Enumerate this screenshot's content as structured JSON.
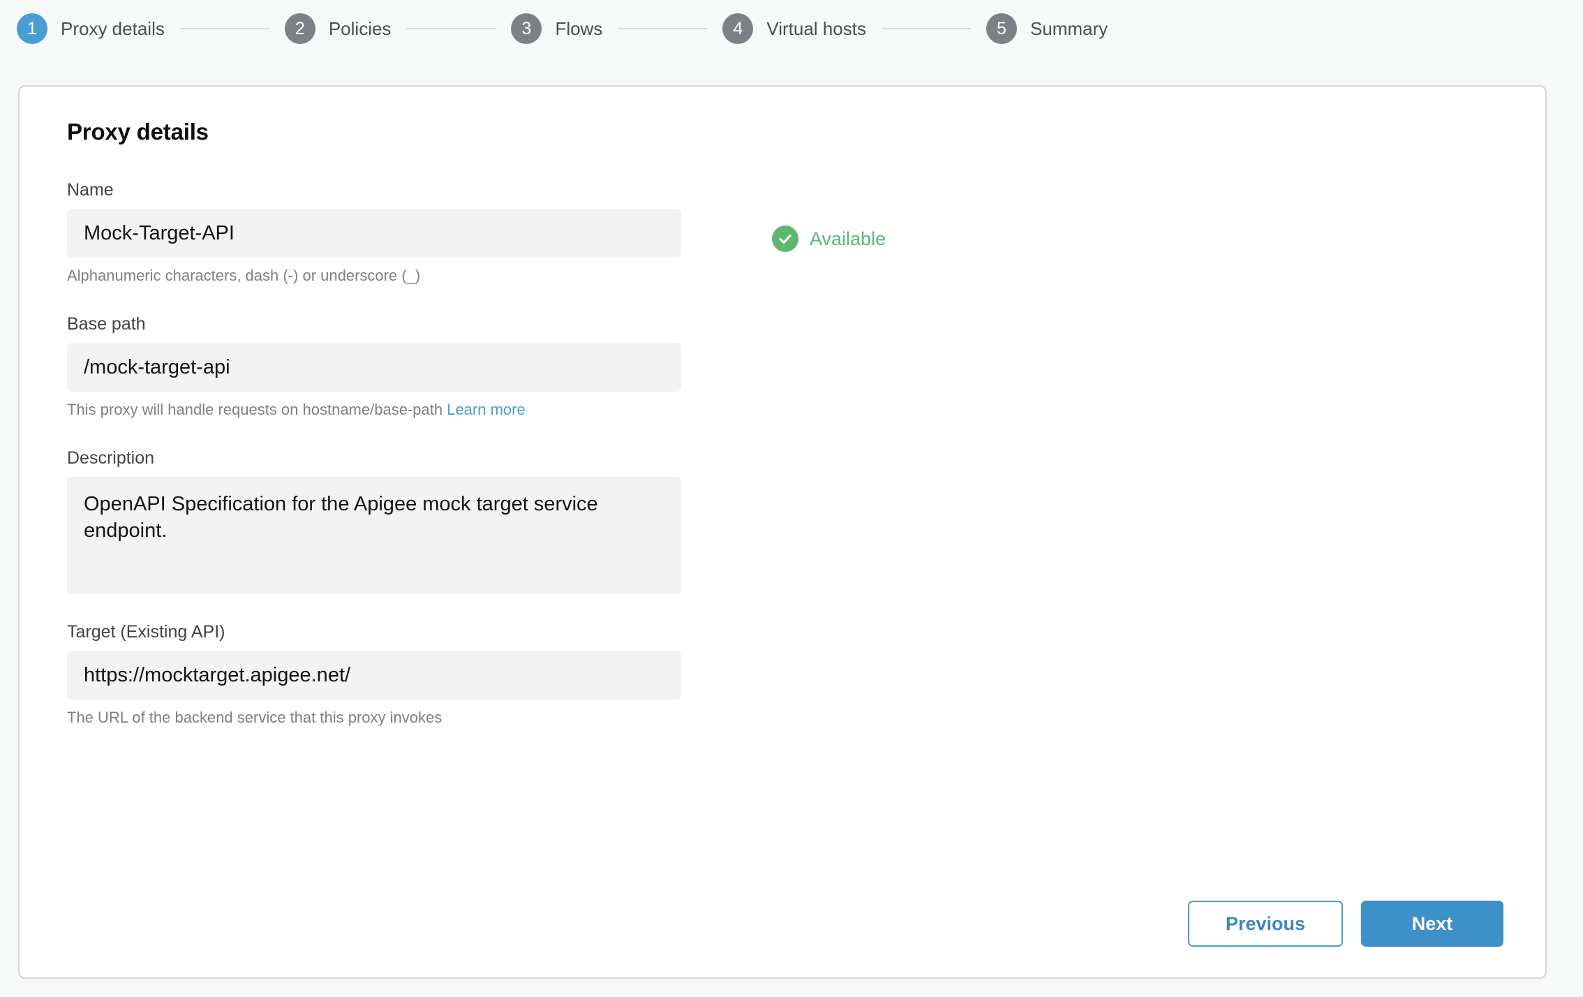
{
  "stepper": {
    "steps": [
      {
        "number": "1",
        "label": "Proxy details",
        "state": "active"
      },
      {
        "number": "2",
        "label": "Policies",
        "state": "inactive"
      },
      {
        "number": "3",
        "label": "Flows",
        "state": "inactive"
      },
      {
        "number": "4",
        "label": "Virtual hosts",
        "state": "inactive"
      },
      {
        "number": "5",
        "label": "Summary",
        "state": "inactive"
      }
    ]
  },
  "card": {
    "title": "Proxy details",
    "fields": {
      "name": {
        "label": "Name",
        "value": "Mock-Target-API",
        "help": "Alphanumeric characters, dash (-) or underscore (_)"
      },
      "base_path": {
        "label": "Base path",
        "value": "/mock-target-api",
        "help": "This proxy will handle requests on hostname/base-path",
        "link_label": "Learn more"
      },
      "description": {
        "label": "Description",
        "value": "OpenAPI Specification for the Apigee mock target service endpoint."
      },
      "target": {
        "label": "Target (Existing API)",
        "value": "https://mocktarget.apigee.net/",
        "help": "The URL of the backend service that this proxy invokes"
      }
    },
    "availability": {
      "status": "Available",
      "icon": "check-circle-icon"
    },
    "footer": {
      "previous_label": "Previous",
      "next_label": "Next"
    }
  },
  "colors": {
    "accent_blue": "#4a9dd4",
    "primary_button_blue": "#3e90c8",
    "success_green": "#5cb773",
    "step_inactive_gray": "#7b8184",
    "page_background": "#f7f8f8",
    "input_background": "#f3f3f3",
    "card_border": "#d5d7d8"
  }
}
